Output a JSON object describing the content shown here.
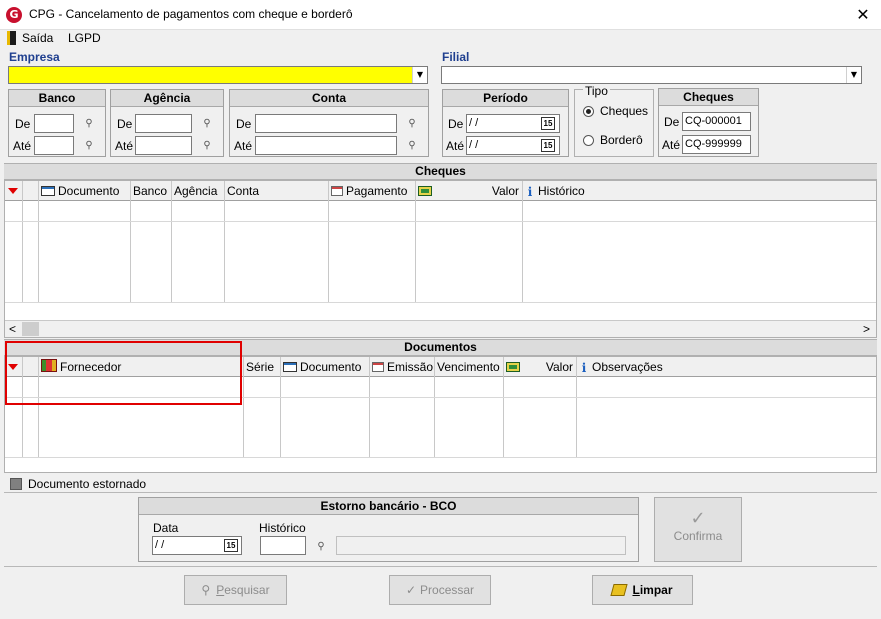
{
  "window": {
    "title": "CPG - Cancelamento de pagamentos com cheque e borderô",
    "close_glyph": "✕",
    "app_icon_letter": "G"
  },
  "menu": [
    {
      "label": "Saída"
    },
    {
      "label": "LGPD"
    }
  ],
  "empresa": {
    "label": "Empresa",
    "value": ""
  },
  "filial": {
    "label": "Filial",
    "value": ""
  },
  "banco": {
    "title": "Banco",
    "de_label": "De",
    "ate_label": "Até",
    "de": "",
    "ate": ""
  },
  "agencia": {
    "title": "Agência",
    "de_label": "De",
    "ate_label": "Até",
    "de": "",
    "ate": ""
  },
  "conta": {
    "title": "Conta",
    "de_label": "De",
    "ate_label": "Até",
    "de": "",
    "ate": ""
  },
  "periodo": {
    "title": "Período",
    "de_label": "De",
    "ate_label": "Até",
    "de": " /  /",
    "ate": " /  /",
    "cal_label": "15"
  },
  "tipo": {
    "title": "Tipo",
    "options": [
      "Cheques",
      "Borderô"
    ],
    "selected": "Cheques"
  },
  "cheques_range": {
    "title": "Cheques",
    "de_label": "De",
    "ate_label": "Até",
    "de": "CQ-000001",
    "ate": "CQ-999999"
  },
  "cheques_grid": {
    "title": "Cheques",
    "columns": [
      "Documento",
      "Banco",
      "Agência",
      "Conta",
      "Pagamento",
      "Valor",
      "Histórico"
    ],
    "scroll_left": "<",
    "scroll_right": ">"
  },
  "documentos_grid": {
    "title": "Documentos",
    "columns": [
      "Fornecedor",
      "Série",
      "Documento",
      "Emissão",
      "Vencimento",
      "Valor",
      "Observações"
    ]
  },
  "legend": {
    "label": "Documento estornado"
  },
  "estorno": {
    "title": "Estorno bancário - BCO",
    "data_label": "Data",
    "data_value": " /  /",
    "historico_label": "Histórico",
    "historico_code": "",
    "historico_desc": "",
    "cal_label": "15"
  },
  "buttons": {
    "confirma": "Confirma",
    "pesquisar_key": "P",
    "pesquisar_rest": "esquisar",
    "processar": "Processar",
    "limpar_key": "L",
    "limpar_rest": "impar"
  },
  "icons": {
    "binoculars": "binoculars-icon",
    "calendar": "calendar-icon",
    "check": "check-icon"
  },
  "colors": {
    "required_field": "#ffff00",
    "highlight": "#e00000",
    "label_blue": "#1f3f8f"
  }
}
